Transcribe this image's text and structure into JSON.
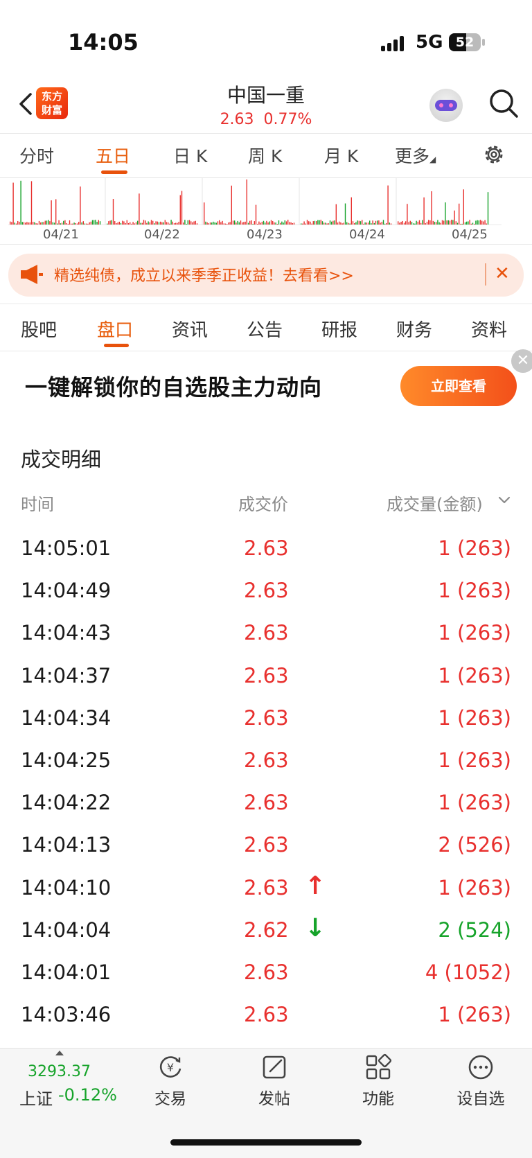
{
  "status": {
    "time": "14:05",
    "network": "5G",
    "battery": "52"
  },
  "header": {
    "logo": "东方财富",
    "title": "中国一重",
    "price": "2.63",
    "change_pct": "0.77%"
  },
  "chart_tabs": {
    "items": [
      {
        "label": "分时"
      },
      {
        "label": "五日"
      },
      {
        "label": "日 K"
      },
      {
        "label": "周 K"
      },
      {
        "label": "月 K"
      },
      {
        "label": "更多"
      }
    ],
    "active": "五日"
  },
  "mini_chart": {
    "dates": [
      "04/21",
      "04/22",
      "04/23",
      "04/24",
      "04/25"
    ]
  },
  "banner": {
    "text": "精选纯债，成立以来季季正收益！去看看>>"
  },
  "section_tabs": {
    "items": [
      {
        "label": "股吧"
      },
      {
        "label": "盘口"
      },
      {
        "label": "资讯"
      },
      {
        "label": "公告"
      },
      {
        "label": "研报"
      },
      {
        "label": "财务"
      },
      {
        "label": "资料"
      }
    ],
    "active": "盘口"
  },
  "ad": {
    "text": "一键解锁你的自选股主力动向",
    "button": "立即查看"
  },
  "trades": {
    "title": "成交明细",
    "headers": {
      "time": "时间",
      "price": "成交价",
      "volume": "成交量(金额)"
    },
    "rows": [
      {
        "time": "14:05:01",
        "price": "2.63",
        "arrow": "",
        "volume": "1 (263)",
        "vcolor": "red"
      },
      {
        "time": "14:04:49",
        "price": "2.63",
        "arrow": "",
        "volume": "1 (263)",
        "vcolor": "red"
      },
      {
        "time": "14:04:43",
        "price": "2.63",
        "arrow": "",
        "volume": "1 (263)",
        "vcolor": "red"
      },
      {
        "time": "14:04:37",
        "price": "2.63",
        "arrow": "",
        "volume": "1 (263)",
        "vcolor": "red"
      },
      {
        "time": "14:04:34",
        "price": "2.63",
        "arrow": "",
        "volume": "1 (263)",
        "vcolor": "red"
      },
      {
        "time": "14:04:25",
        "price": "2.63",
        "arrow": "",
        "volume": "1 (263)",
        "vcolor": "red"
      },
      {
        "time": "14:04:22",
        "price": "2.63",
        "arrow": "",
        "volume": "1 (263)",
        "vcolor": "red"
      },
      {
        "time": "14:04:13",
        "price": "2.63",
        "arrow": "",
        "volume": "2 (526)",
        "vcolor": "red"
      },
      {
        "time": "14:04:10",
        "price": "2.63",
        "arrow": "↑",
        "volume": "1 (263)",
        "vcolor": "red"
      },
      {
        "time": "14:04:04",
        "price": "2.62",
        "arrow": "↓",
        "volume": "2 (524)",
        "vcolor": "green"
      },
      {
        "time": "14:04:01",
        "price": "2.63",
        "arrow": "",
        "volume": "4 (1052)",
        "vcolor": "red"
      },
      {
        "time": "14:03:46",
        "price": "2.63",
        "arrow": "",
        "volume": "1 (263)",
        "vcolor": "red"
      }
    ]
  },
  "bottom_bar": {
    "index_value": "3293.37",
    "index_name": "上证",
    "index_change": "-0.12%",
    "nav": [
      {
        "label": "交易",
        "icon": "trade-icon"
      },
      {
        "label": "发帖",
        "icon": "post-icon"
      },
      {
        "label": "功能",
        "icon": "apps-icon"
      },
      {
        "label": "设自选",
        "icon": "more-icon"
      }
    ]
  },
  "colors": {
    "up": "#e8302e",
    "down": "#16a32a",
    "accent": "#e85d0c"
  }
}
